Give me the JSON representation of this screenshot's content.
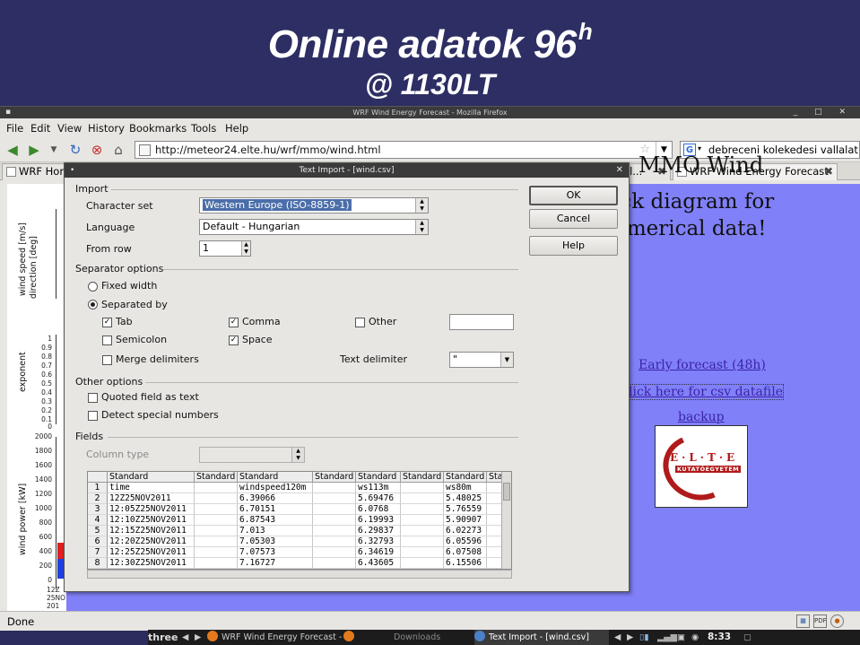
{
  "slide": {
    "title": "Online adatok 96",
    "title_sup": "h",
    "subtitle": "@ 1130LT"
  },
  "firefox": {
    "window_title": "WRF Wind Energy Forecast - Mozilla Firefox",
    "menu": [
      "File",
      "Edit",
      "View",
      "History",
      "Bookmarks",
      "Tools",
      "Help"
    ],
    "url": "http://meteor24.elte.hu/wrf/mmo/wind.html",
    "search_text": "debreceni kolekedesi vallalat",
    "tabs": [
      {
        "label": "WRF Hom"
      },
      {
        "label": "el..."
      },
      {
        "label": "WRF Wind Energy Forecast"
      }
    ],
    "status": "Done"
  },
  "page": {
    "heading": "MMO Wind",
    "click_line1": "ick diagram for",
    "click_line2": "umerical data!",
    "link_early": "Early forecast (48h)",
    "link_csv": "lick here for csv datafile",
    "link_backup": "backup",
    "logo_text": "E·L·T·E",
    "logo_sub": "KUTATÓEGYETEM",
    "chart_labels": {
      "wind_speed": "wind speed [m/s]",
      "direction": "direction [deg]",
      "exponent": "exponent",
      "power": "wind power [kW]"
    },
    "power_ticks": [
      "2000",
      "1800",
      "1600",
      "1400",
      "1200",
      "1000",
      "800",
      "600",
      "400",
      "200",
      "0"
    ],
    "exp_ticks": [
      "1",
      "0.9",
      "0.8",
      "0.7",
      "0.6",
      "0.5",
      "0.4",
      "0.3",
      "0.2",
      "0.1",
      "0"
    ],
    "x_labels": [
      "12Z",
      "25NO",
      "201"
    ]
  },
  "dialog": {
    "title": "Text Import - [wind.csv]",
    "import_label": "Import",
    "charset_label": "Character set",
    "charset_value": "Western Europe (ISO-8859-1)",
    "language_label": "Language",
    "language_value": "Default - Hungarian",
    "fromrow_label": "From row",
    "fromrow_value": "1",
    "separator_label": "Separator options",
    "fixed_width": "Fixed width",
    "separated_by": "Separated by",
    "tab": "Tab",
    "comma": "Comma",
    "other": "Other",
    "semicolon": "Semicolon",
    "space": "Space",
    "merge": "Merge delimiters",
    "text_delim_label": "Text delimiter",
    "text_delim_value": "\"",
    "other_options": "Other options",
    "quoted": "Quoted field as text",
    "detect": "Detect special numbers",
    "fields": "Fields",
    "column_type": "Column type",
    "ok": "OK",
    "cancel": "Cancel",
    "help": "Help",
    "grid_headers": [
      "Standard",
      "Standard",
      "Standard",
      "Standard",
      "Standard",
      "Standard",
      "Standard",
      "Sta"
    ],
    "grid_rows": [
      {
        "n": "1",
        "c": [
          "time",
          "",
          "windspeed120m",
          "",
          "ws113m",
          "",
          "ws80m"
        ]
      },
      {
        "n": "2",
        "c": [
          "12Z25NOV2011",
          "",
          "6.39066",
          "",
          "5.69476",
          "",
          "5.48025"
        ]
      },
      {
        "n": "3",
        "c": [
          "12:05Z25NOV2011",
          "",
          "6.70151",
          "",
          "6.0768",
          "",
          "5.76559"
        ]
      },
      {
        "n": "4",
        "c": [
          "12:10Z25NOV2011",
          "",
          "6.87543",
          "",
          "6.19993",
          "",
          "5.90907"
        ]
      },
      {
        "n": "5",
        "c": [
          "12:15Z25NOV2011",
          "",
          "7.013",
          "",
          "6.29837",
          "",
          "6.02273"
        ]
      },
      {
        "n": "6",
        "c": [
          "12:20Z25NOV2011",
          "",
          "7.05303",
          "",
          "6.32793",
          "",
          "6.05596"
        ]
      },
      {
        "n": "7",
        "c": [
          "12:25Z25NOV2011",
          "",
          "7.07573",
          "",
          "6.34619",
          "",
          "6.07508"
        ]
      },
      {
        "n": "8",
        "c": [
          "12:30Z25NOV2011",
          "",
          "7.16727",
          "",
          "6.43605",
          "",
          "6.15506"
        ]
      }
    ]
  },
  "taskbar": {
    "workspace": "three",
    "task1": "WRF Wind Energy Forecast - M",
    "task2": "Downloads",
    "task3": "Text Import - [wind.csv]",
    "clock": "8:33"
  }
}
